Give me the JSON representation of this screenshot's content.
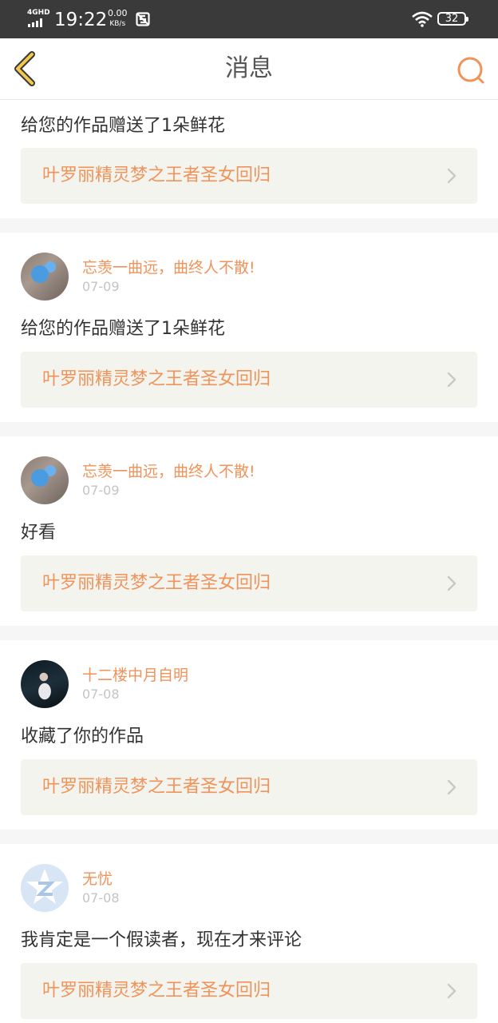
{
  "status_bar": {
    "network": "4GHD",
    "time": "19:22",
    "speed_value": "0.00",
    "speed_unit": "KB/s",
    "battery": "32",
    "icons": [
      "signal-icon",
      "notification-icon",
      "wifi-icon",
      "battery-icon"
    ]
  },
  "header": {
    "title": "消息",
    "back_icon": "chevron-left-icon",
    "search_icon": "search-icon",
    "accent_color": "#f0935a"
  },
  "messages": [
    {
      "user": null,
      "date": null,
      "text": "给您的作品赠送了1朵鲜花",
      "work": "叶罗丽精灵梦之王者圣女回归"
    },
    {
      "user": "忘羡一曲远，曲终人不散!",
      "date": "07-09",
      "text": "给您的作品赠送了1朵鲜花",
      "work": "叶罗丽精灵梦之王者圣女回归"
    },
    {
      "user": "忘羡一曲远，曲终人不散!",
      "date": "07-09",
      "text": "好看",
      "work": "叶罗丽精灵梦之王者圣女回归"
    },
    {
      "user": "十二楼中月自明",
      "date": "07-08",
      "text": "收藏了你的作品",
      "work": "叶罗丽精灵梦之王者圣女回归"
    },
    {
      "user": "无忧",
      "date": "07-08",
      "text": "我肯定是一个假读者，现在才来评论",
      "work": "叶罗丽精灵梦之王者圣女回归"
    }
  ]
}
